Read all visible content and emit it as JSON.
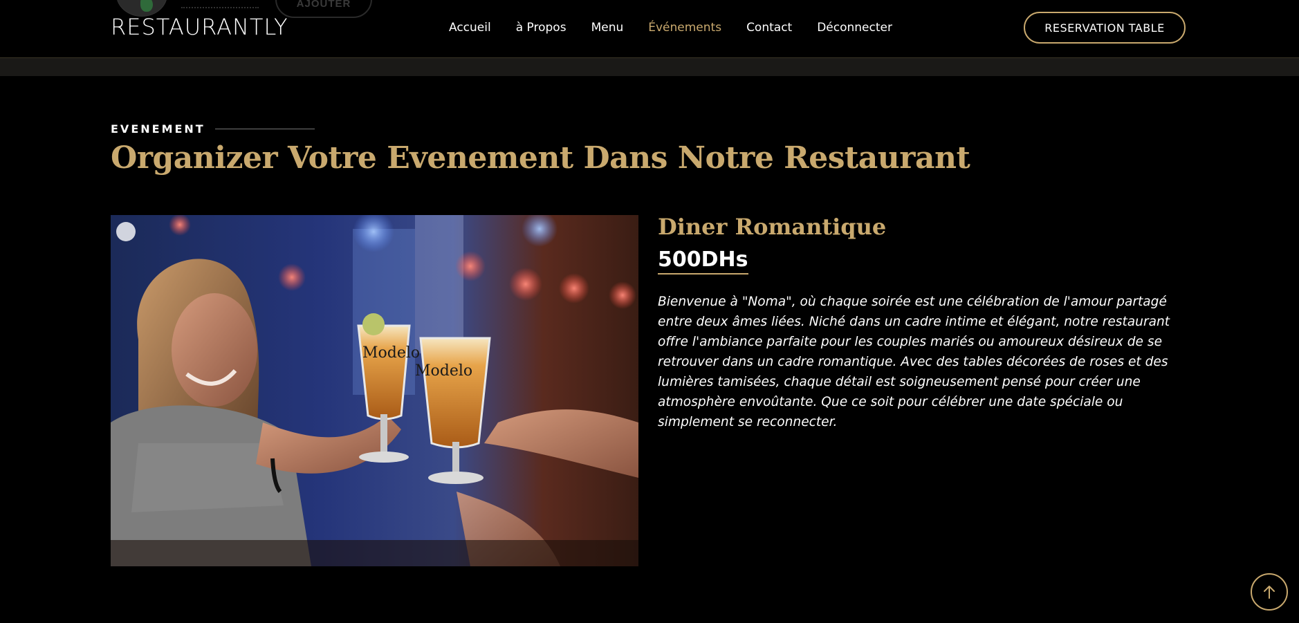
{
  "header": {
    "logo": "RESTAURANTLY",
    "ghost_button": "AJOUTER",
    "nav": [
      {
        "label": "Accueil",
        "active": false
      },
      {
        "label": "à Propos",
        "active": false
      },
      {
        "label": "Menu",
        "active": false
      },
      {
        "label": "Événements",
        "active": true
      },
      {
        "label": "Contact",
        "active": false
      },
      {
        "label": "Déconnecter",
        "active": false
      }
    ],
    "reserve_label": "RESERVATION TABLE"
  },
  "section": {
    "eyebrow": "EVENEMENT",
    "title": "Organizer Votre Evenement Dans Notre Restaurant"
  },
  "event": {
    "title": "Diner Romantique",
    "price": "500DHs",
    "description": "Bienvenue à \"Noma\", où chaque soirée est une célébration de l'amour partagé entre deux âmes liées. Niché dans un cadre intime et élégant, notre restaurant offre l'ambiance parfaite pour les couples mariés ou amoureux désireux de se retrouver dans un cadre romantique. Avec des tables décorées de roses et des lumières tamisées, chaque détail est soigneusement pensé pour créer une atmosphère envoûtante. Que ce soit pour célébrer une date spéciale ou simplement se reconnecter.",
    "image_alt": "",
    "glass_brand": "Modelo"
  },
  "colors": {
    "accent": "#c9a96e",
    "background": "#000000",
    "strip": "#1a1917"
  },
  "icons": {
    "scroll_top": "arrow-up-icon"
  }
}
